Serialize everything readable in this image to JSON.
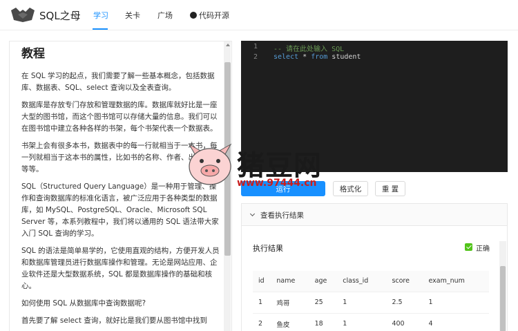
{
  "brand": {
    "name": "SQL之母"
  },
  "nav": {
    "items": [
      {
        "label": "学习",
        "active": true
      },
      {
        "label": "关卡"
      },
      {
        "label": "广场"
      },
      {
        "label": "代码开源",
        "icon": "github-icon"
      }
    ]
  },
  "tutorial": {
    "title": "教程",
    "paragraphs": [
      "在 SQL 学习的起点，我们需要了解一些基本概念，包括数据库、数据表、SQL、select 查询以及全表查询。",
      "数据库是存放专门存放和管理数据的库。数据库就好比是一座大型的图书馆，而这个图书馆可以存储大量的信息。我们可以在图书馆中建立各种各样的书架，每个书架代表一个数据表。",
      "书架上会有很多本书，数据表中的每一行就相当于一本书，每一列就相当于这本书的属性，比如书的名称、作者、出版日期等等。",
      "SQL（Structured Query Language）是一种用于管理、操作和查询数据库的标准化语言，被广泛应用于各种类型的数据库，如 MySQL、PostgreSQL、Oracle、Microsoft SQL Server 等，本系列教程中，我们将以通用的 SQL 语法带大家入门 SQL 查询的学习。",
      "SQL 的语法是简单易学的，它使用直观的结构，方便开发人员和数据库管理员进行数据库操作和管理。无论是网站应用、企业软件还是大型数据系统，SQL 都是数据库操作的基础和核心。",
      "如何使用 SQL 从数据库中查询数据呢?",
      "首先要了解 select 查询，就好比是我们要从图书馆中找到"
    ]
  },
  "editor": {
    "lines": [
      {
        "num": "1",
        "comment": "-- 请在此处输入 SQL"
      },
      {
        "num": "2",
        "kw1": "select",
        "star": " * ",
        "kw2": "from",
        "ident": " student"
      }
    ]
  },
  "buttons": {
    "run": "运行",
    "format": "格式化",
    "reset": "重 置"
  },
  "results": {
    "panel_label": "查看执行结果",
    "title": "执行结果",
    "status": "正确",
    "columns": [
      "id",
      "name",
      "age",
      "class_id",
      "score",
      "exam_num"
    ],
    "rows": [
      [
        "1",
        "鸡哥",
        "25",
        "1",
        "2.5",
        "1"
      ],
      [
        "2",
        "鱼皮",
        "18",
        "1",
        "400",
        "4"
      ]
    ]
  },
  "watermark": {
    "text": "猪豆网",
    "url": "www.97444.cn"
  },
  "colors": {
    "accent": "#1890ff",
    "success": "#52c41a",
    "editor_bg": "#1e1e1e"
  }
}
